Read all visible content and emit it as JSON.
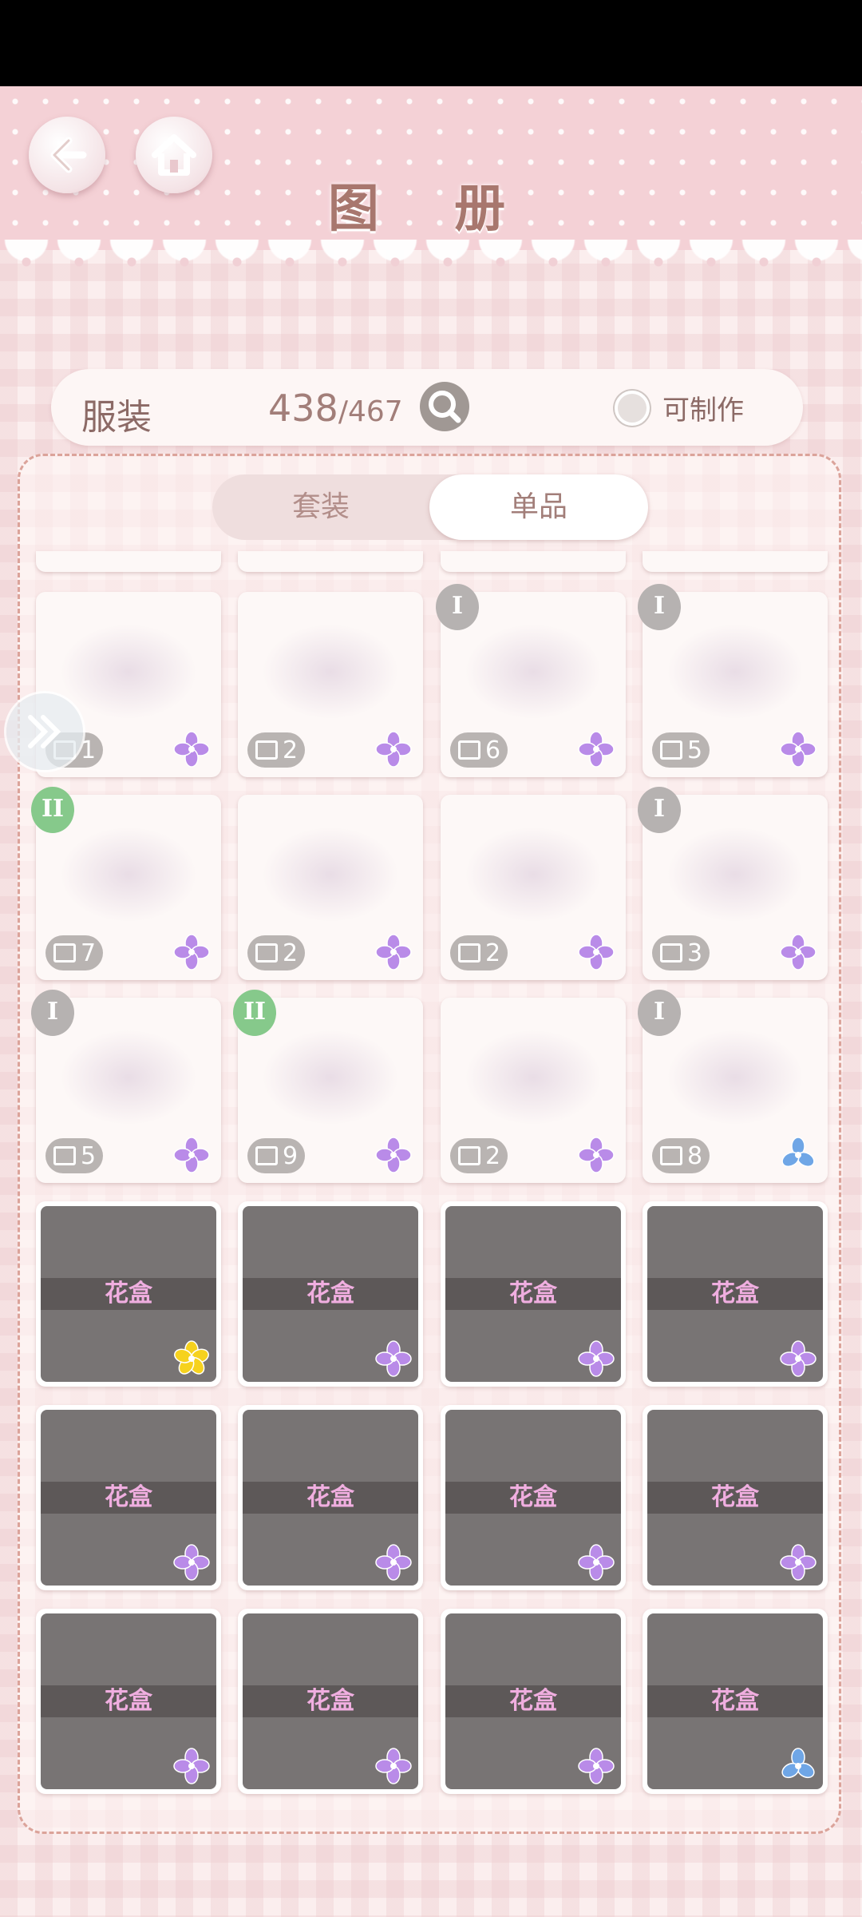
{
  "header": {
    "title": "图 册"
  },
  "info": {
    "category": "服装",
    "owned": "438",
    "total": "/467",
    "craft_label": "可制作"
  },
  "tabs": [
    {
      "label": "套装",
      "active": false
    },
    {
      "label": "单品",
      "active": true
    }
  ],
  "colors": {
    "header_bg": "#f4d1d6",
    "accent": "#a27e79",
    "tier1": "#b6b2b1",
    "tier2": "#86c98b",
    "flower_purple": "#b98be8",
    "flower_yellow": "#f6d21e",
    "flower_blue": "#6fa6e6"
  },
  "items": [
    {
      "count": "1",
      "tier": "",
      "rarity": "purple",
      "locked": false
    },
    {
      "count": "2",
      "tier": "",
      "rarity": "purple",
      "locked": false
    },
    {
      "count": "6",
      "tier": "I",
      "rarity": "purple",
      "locked": false
    },
    {
      "count": "5",
      "tier": "I",
      "rarity": "purple",
      "locked": false
    },
    {
      "count": "7",
      "tier": "II",
      "rarity": "purple",
      "locked": false
    },
    {
      "count": "2",
      "tier": "",
      "rarity": "purple",
      "locked": false
    },
    {
      "count": "2",
      "tier": "",
      "rarity": "purple",
      "locked": false
    },
    {
      "count": "3",
      "tier": "I",
      "rarity": "purple",
      "locked": false
    },
    {
      "count": "5",
      "tier": "I",
      "rarity": "purple",
      "locked": false
    },
    {
      "count": "9",
      "tier": "II",
      "rarity": "purple",
      "locked": false
    },
    {
      "count": "2",
      "tier": "",
      "rarity": "purple",
      "locked": false
    },
    {
      "count": "8",
      "tier": "I",
      "rarity": "blue",
      "locked": false
    },
    {
      "label": "花盒",
      "rarity": "yellow",
      "locked": true
    },
    {
      "label": "花盒",
      "rarity": "purple",
      "locked": true
    },
    {
      "label": "花盒",
      "rarity": "purple",
      "locked": true
    },
    {
      "label": "花盒",
      "rarity": "purple",
      "locked": true
    },
    {
      "label": "花盒",
      "rarity": "purple",
      "locked": true
    },
    {
      "label": "花盒",
      "rarity": "purple",
      "locked": true
    },
    {
      "label": "花盒",
      "rarity": "purple",
      "locked": true
    },
    {
      "label": "花盒",
      "rarity": "purple",
      "locked": true
    },
    {
      "label": "花盒",
      "rarity": "purple",
      "locked": true
    },
    {
      "label": "花盒",
      "rarity": "purple",
      "locked": true
    },
    {
      "label": "花盒",
      "rarity": "purple",
      "locked": true
    },
    {
      "label": "花盒",
      "rarity": "blue",
      "locked": true
    }
  ]
}
